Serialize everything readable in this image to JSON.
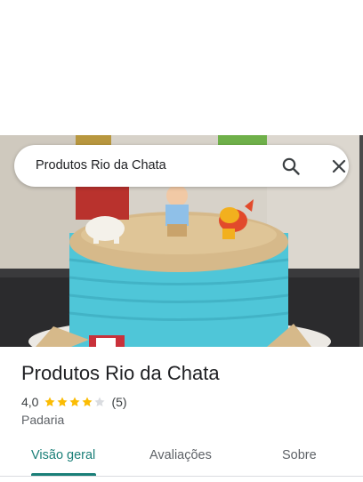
{
  "search": {
    "query": "Produtos Rio da Chata",
    "search_icon": "search-icon",
    "close_icon": "close-icon"
  },
  "place": {
    "name": "Produtos Rio da Chata",
    "rating": "4,0",
    "rating_stars": 4,
    "rating_max": 5,
    "reviews": "(5)",
    "category": "Padaria"
  },
  "tabs": [
    {
      "label": "Visão geral",
      "active": true
    },
    {
      "label": "Avaliações",
      "active": false
    },
    {
      "label": "Sobre",
      "active": false
    }
  ],
  "colors": {
    "accent": "#1a7f78",
    "star_filled": "#fbbc04",
    "star_empty": "#dadce0"
  }
}
